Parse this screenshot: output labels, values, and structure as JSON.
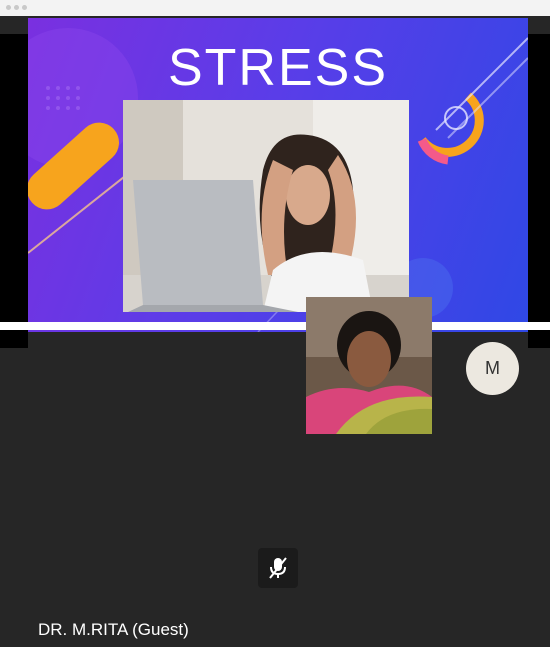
{
  "slide": {
    "title": "STRESS"
  },
  "participants": {
    "avatar_initial": "M",
    "speaker_name": "DR. M.RITA (Guest)"
  },
  "icons": {
    "mute": "microphone-muted-icon"
  },
  "colors": {
    "call_background": "#262626",
    "slide_gradient_start": "#7a30e0",
    "slide_gradient_end": "#2f48e6",
    "accent_orange": "#f7a41d",
    "accent_pink": "#f45a8a"
  }
}
